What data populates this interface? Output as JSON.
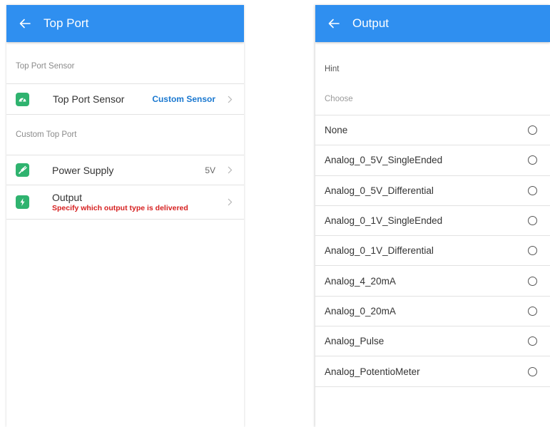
{
  "left": {
    "title": "Top Port",
    "sections": [
      {
        "header": "Top Port Sensor",
        "rows": [
          {
            "label": "Top Port Sensor",
            "value": "Custom Sensor",
            "icon": "speedometer-icon"
          }
        ]
      },
      {
        "header": "Custom Top Port",
        "rows": [
          {
            "label": "Power Supply",
            "value": "5V",
            "icon": "plug-icon"
          },
          {
            "label": "Output",
            "sublabel": "Specify which output type is delivered",
            "icon": "lightning-icon"
          }
        ]
      }
    ]
  },
  "right": {
    "title": "Output",
    "hint": "Hint",
    "choose": "Choose",
    "options": [
      "None",
      "Analog_0_5V_SingleEnded",
      "Analog_0_5V_Differential",
      "Analog_0_1V_SingleEnded",
      "Analog_0_1V_Differential",
      "Analog_4_20mA",
      "Analog_0_20mA",
      "Analog_Pulse",
      "Analog_PotentioMeter"
    ]
  },
  "colors": {
    "appbar": "#2f8ff0",
    "icon_green": "#2fb36f",
    "accent_blue": "#1a78d0",
    "warning_red": "#d62020"
  }
}
